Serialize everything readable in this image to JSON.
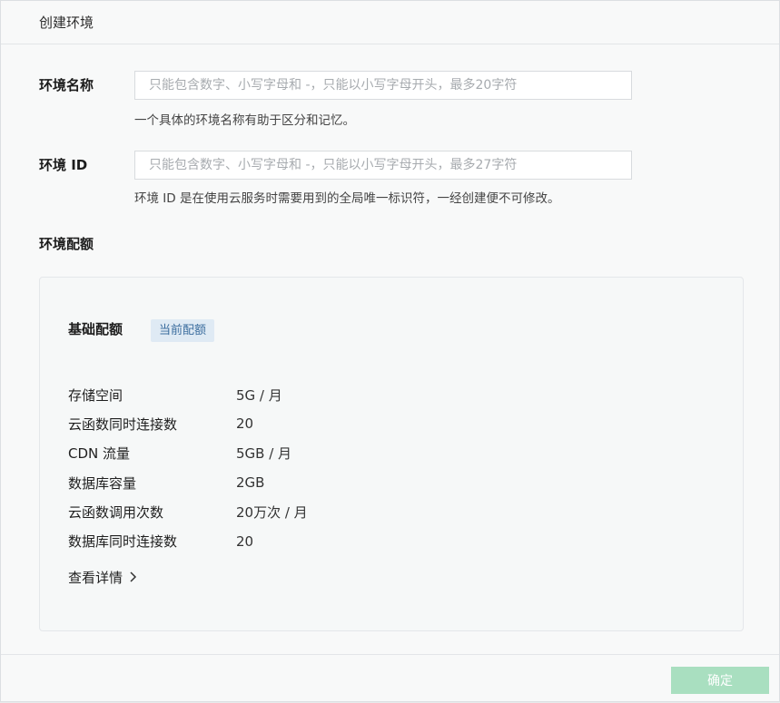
{
  "dialog": {
    "title": "创建环境"
  },
  "form": {
    "env_name": {
      "label": "环境名称",
      "value": "",
      "placeholder": "只能包含数字、小写字母和 -，只能以小写字母开头，最多20字符",
      "hint": "一个具体的环境名称有助于区分和记忆。"
    },
    "env_id": {
      "label": "环境 ID",
      "value": "",
      "placeholder": "只能包含数字、小写字母和 -，只能以小写字母开头，最多27字符",
      "hint": "环境 ID 是在使用云服务时需要用到的全局唯一标识符，一经创建便不可修改。"
    }
  },
  "quota": {
    "section_title": "环境配额",
    "plan_name": "基础配额",
    "plan_badge": "当前配额",
    "items": [
      {
        "name": "存储空间",
        "value": "5G / 月"
      },
      {
        "name": "云函数同时连接数",
        "value": "20"
      },
      {
        "name": "CDN 流量",
        "value": "5GB / 月"
      },
      {
        "name": "数据库容量",
        "value": "2GB"
      },
      {
        "name": "云函数调用次数",
        "value": "20万次 / 月"
      },
      {
        "name": "数据库同时连接数",
        "value": "20"
      }
    ],
    "details_link": "查看详情",
    "details_icon": "chevron-right-icon"
  },
  "footer": {
    "confirm_label": "确定"
  },
  "colors": {
    "confirm_disabled_bg": "#a9dfc0",
    "badge_bg": "#dfeaf4",
    "badge_text": "#3b6d9e"
  }
}
